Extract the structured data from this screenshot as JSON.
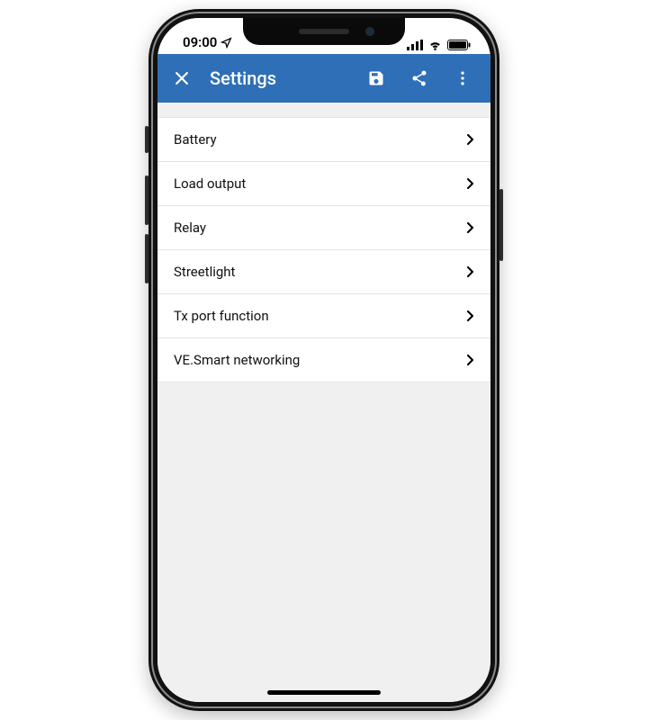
{
  "statusbar": {
    "time": "09:00"
  },
  "appbar": {
    "title": "Settings",
    "accent": "#2f6fb7"
  },
  "settings": {
    "items": [
      {
        "label": "Battery"
      },
      {
        "label": "Load output"
      },
      {
        "label": "Relay"
      },
      {
        "label": "Streetlight"
      },
      {
        "label": "Tx port function"
      },
      {
        "label": "VE.Smart networking"
      }
    ]
  }
}
